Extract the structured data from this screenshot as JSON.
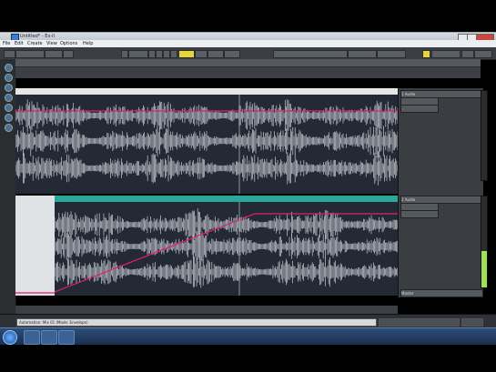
{
  "window": {
    "title": "Untitled* - Ex-ll"
  },
  "menu": {
    "items": [
      "File",
      "Edit",
      "Create",
      "View",
      "Options",
      "Help"
    ]
  },
  "status": {
    "text": "Automation: Mix 01 (Mode: Envelope)"
  },
  "tracks": [
    {
      "name": "1 Audio"
    },
    {
      "name": "2 Audio"
    }
  ],
  "master": {
    "label": "Master"
  },
  "colors": {
    "accent": "#26a89b",
    "automation": "#e0206a",
    "wave": "#c9ccd2",
    "track_bg": "#232a36"
  },
  "icons": [
    "start-orb-icon",
    "folder-icon",
    "media-icon",
    "app-icon",
    "close-icon",
    "minimize-icon",
    "maximize-icon"
  ]
}
